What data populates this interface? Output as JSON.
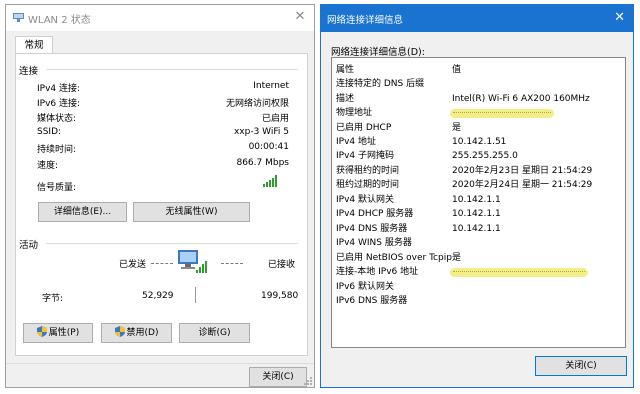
{
  "left_window": {
    "title": "WLAN 2 状态",
    "tab": "常规",
    "connection_title": "连接",
    "rows": [
      {
        "label": "IPv4 连接:",
        "value": "Internet"
      },
      {
        "label": "IPv6 连接:",
        "value": "无网络访问权限"
      },
      {
        "label": "媒体状态:",
        "value": "已启用"
      },
      {
        "label": "SSID:",
        "value": "xxp-3 WiFi 5"
      },
      {
        "label": "持续时间:",
        "value": "00:00:41"
      },
      {
        "label": "速度:",
        "value": "866.7 Mbps"
      }
    ],
    "signal_label": "信号质量:",
    "details_button": "详细信息(E)...",
    "wireless_button": "无线属性(W)",
    "activity_title": "活动",
    "sent_label": "已发送",
    "received_label": "已接收",
    "bytes_label": "字节:",
    "bytes_sent": "52,929",
    "bytes_received": "199,580",
    "properties_button": "属性(P)",
    "disable_button": "禁用(D)",
    "diagnose_button": "诊断(G)",
    "close_button": "关闭(C)"
  },
  "right_window": {
    "title": "网络连接详细信息",
    "list_label": "网络连接详细信息(D):",
    "header_property": "属性",
    "header_value": "值",
    "rows": [
      {
        "property": "连接特定的 DNS 后缀",
        "value": ""
      },
      {
        "property": "描述",
        "value": "Intel(R) Wi-Fi 6 AX200 160MHz"
      },
      {
        "property": "物理地址",
        "value": ""
      },
      {
        "property": "已启用 DHCP",
        "value": "是"
      },
      {
        "property": "IPv4 地址",
        "value": "10.142.1.51"
      },
      {
        "property": "IPv4 子网掩码",
        "value": "255.255.255.0"
      },
      {
        "property": "获得租约的时间",
        "value": "2020年2月23日 星期日 21:54:29"
      },
      {
        "property": "租约过期的时间",
        "value": "2020年2月24日 星期一 21:54:29"
      },
      {
        "property": "IPv4 默认网关",
        "value": "10.142.1.1"
      },
      {
        "property": "IPv4 DHCP 服务器",
        "value": "10.142.1.1"
      },
      {
        "property": "IPv4 DNS 服务器",
        "value": "10.142.1.1"
      },
      {
        "property": "IPv4 WINS 服务器",
        "value": ""
      },
      {
        "property": "已启用 NetBIOS over Tcpip",
        "value": "是"
      },
      {
        "property": "连接-本地 IPv6 地址",
        "value": ""
      },
      {
        "property": "IPv6 默认网关",
        "value": ""
      },
      {
        "property": "IPv6 DNS 服务器",
        "value": ""
      }
    ],
    "close_button": "关闭(C)"
  },
  "colors": {
    "accent_titlebar": "#1a73d0",
    "signal_green": "#2e9e2e",
    "redaction_yellow": "#f4ee8a"
  },
  "icons": [
    "wifi-adapter-icon",
    "signal-strength-icon",
    "network-computers-icon",
    "uac-shield-icon",
    "close-icon",
    "resize-grip-icon"
  ]
}
